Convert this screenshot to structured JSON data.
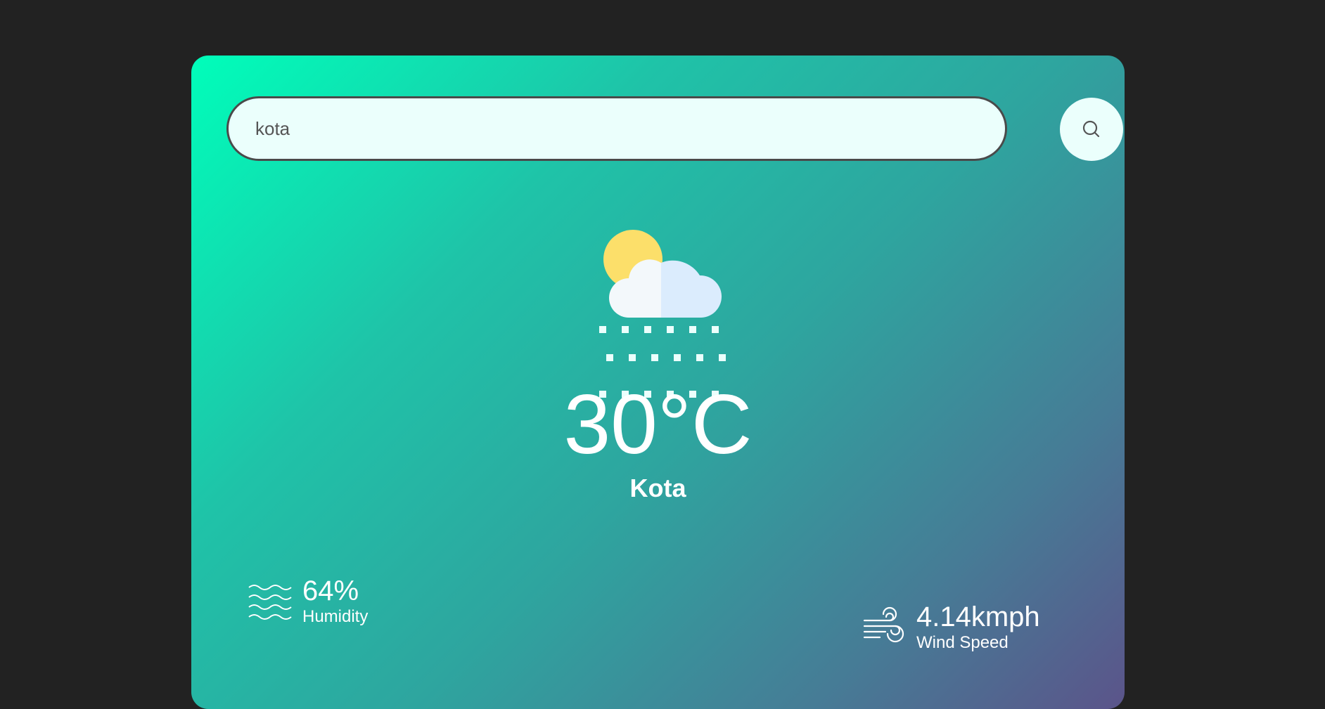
{
  "search": {
    "value": "kota",
    "button_icon": "search-icon"
  },
  "weather": {
    "icon": "sun-cloud-snow-icon",
    "temperature": "30°C",
    "city": "Kota"
  },
  "details": {
    "humidity": {
      "value": "64%",
      "label": "Humidity",
      "icon": "humidity-waves-icon"
    },
    "wind": {
      "value": "4.14kmph",
      "label": "Wind Speed",
      "icon": "wind-icon"
    }
  },
  "colors": {
    "background": "#222222",
    "gradient_start": "#00feba",
    "gradient_end": "#5b548a",
    "input_bg": "#ebfffc"
  }
}
